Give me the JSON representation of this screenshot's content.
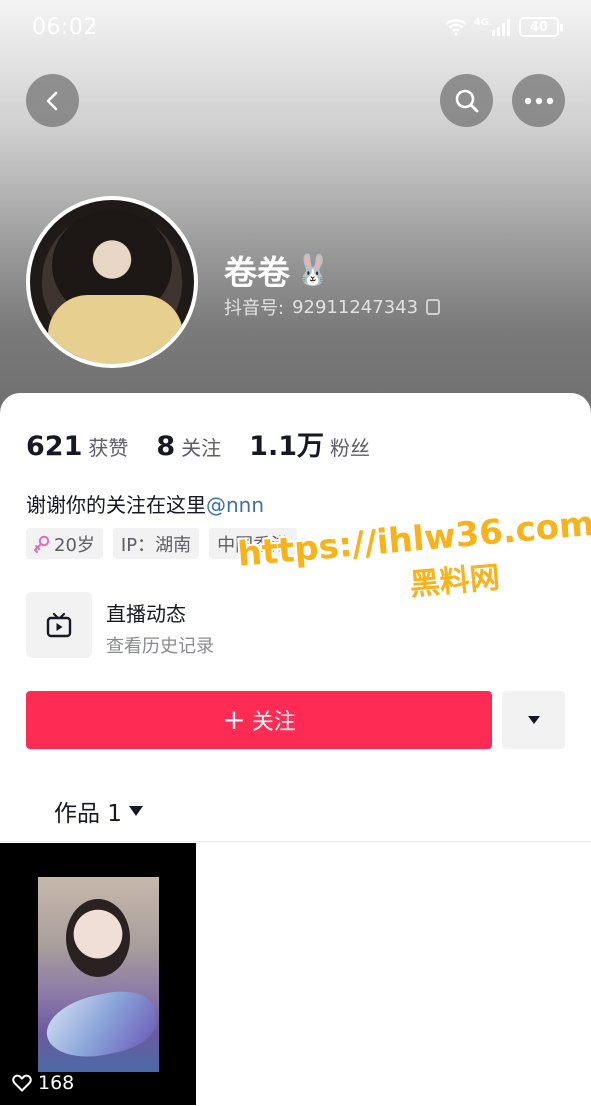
{
  "status_bar": {
    "time": "06:02",
    "network": "4G",
    "battery": "40",
    "icons": [
      "wifi-icon",
      "signal-icon",
      "battery-icon"
    ]
  },
  "nav": {
    "back_icon": "chevron-left-icon",
    "search_icon": "search-icon",
    "more_icon": "more-dots-icon"
  },
  "profile": {
    "name": "卷卷",
    "name_emoji": "🐰",
    "douyin_id_label": "抖音号:",
    "douyin_id": "92911247343"
  },
  "stats": [
    {
      "value": "621",
      "label": "获赞"
    },
    {
      "value": "8",
      "label": "关注"
    },
    {
      "value": "1.1万",
      "label": "粉丝"
    }
  ],
  "bio": {
    "text": "谢谢你的关注在这里",
    "mention": "@nnn"
  },
  "tags": {
    "age": "20岁",
    "ip": "IP：湖南",
    "region": "中国香港"
  },
  "live": {
    "title": "直播动态",
    "subtitle": "查看历史记录"
  },
  "actions": {
    "follow_label": "关注",
    "follow_prefix": "+"
  },
  "tabs": {
    "works_label": "作品 1"
  },
  "videos": [
    {
      "likes": "168"
    }
  ],
  "watermark": {
    "url": "https://ihlw36.com",
    "name": "黑料网"
  },
  "colors": {
    "accent": "#fe2c55",
    "mention": "#3e6fa8",
    "watermark": "#f8b21a",
    "female_symbol": "#e86ab6"
  }
}
